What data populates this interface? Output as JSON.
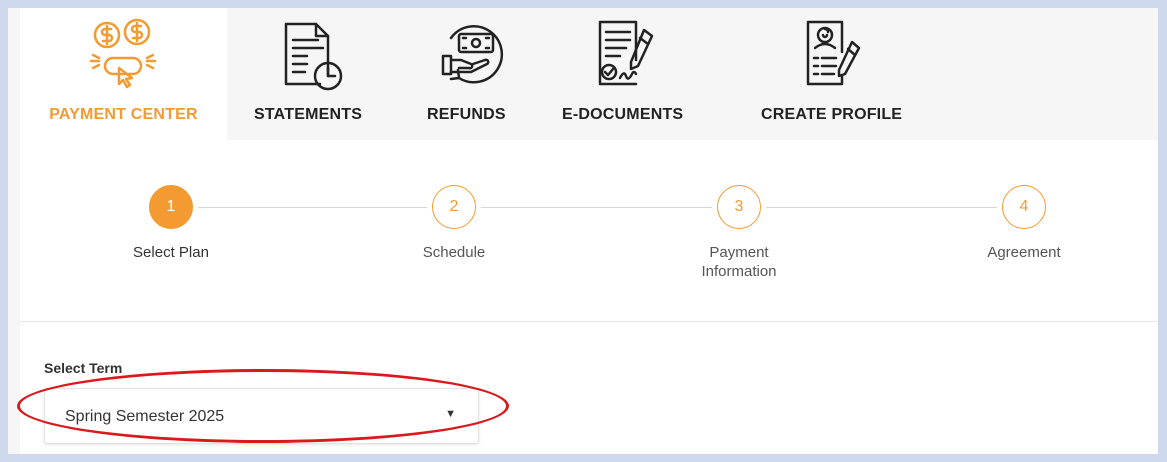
{
  "tabs": [
    {
      "label": "PAYMENT CENTER",
      "icon": "payment-center-icon",
      "active": true
    },
    {
      "label": "STATEMENTS",
      "icon": "statements-icon",
      "active": false
    },
    {
      "label": "REFUNDS",
      "icon": "refunds-icon",
      "active": false
    },
    {
      "label": "E-DOCUMENTS",
      "icon": "e-documents-icon",
      "active": false
    },
    {
      "label": "CREATE PROFILE",
      "icon": "create-profile-icon",
      "active": false
    }
  ],
  "steps": [
    {
      "number": "1",
      "label": "Select Plan",
      "active": true
    },
    {
      "number": "2",
      "label": "Schedule",
      "active": false
    },
    {
      "number": "3",
      "label": "Payment\nInformation",
      "active": false
    },
    {
      "number": "4",
      "label": "Agreement",
      "active": false
    }
  ],
  "term": {
    "label": "Select Term",
    "selected": "Spring Semester 2025",
    "arrow": "▼"
  },
  "colors": {
    "accent": "#f39a30",
    "highlight": "#d9191c",
    "background": "#cfd9ee"
  }
}
